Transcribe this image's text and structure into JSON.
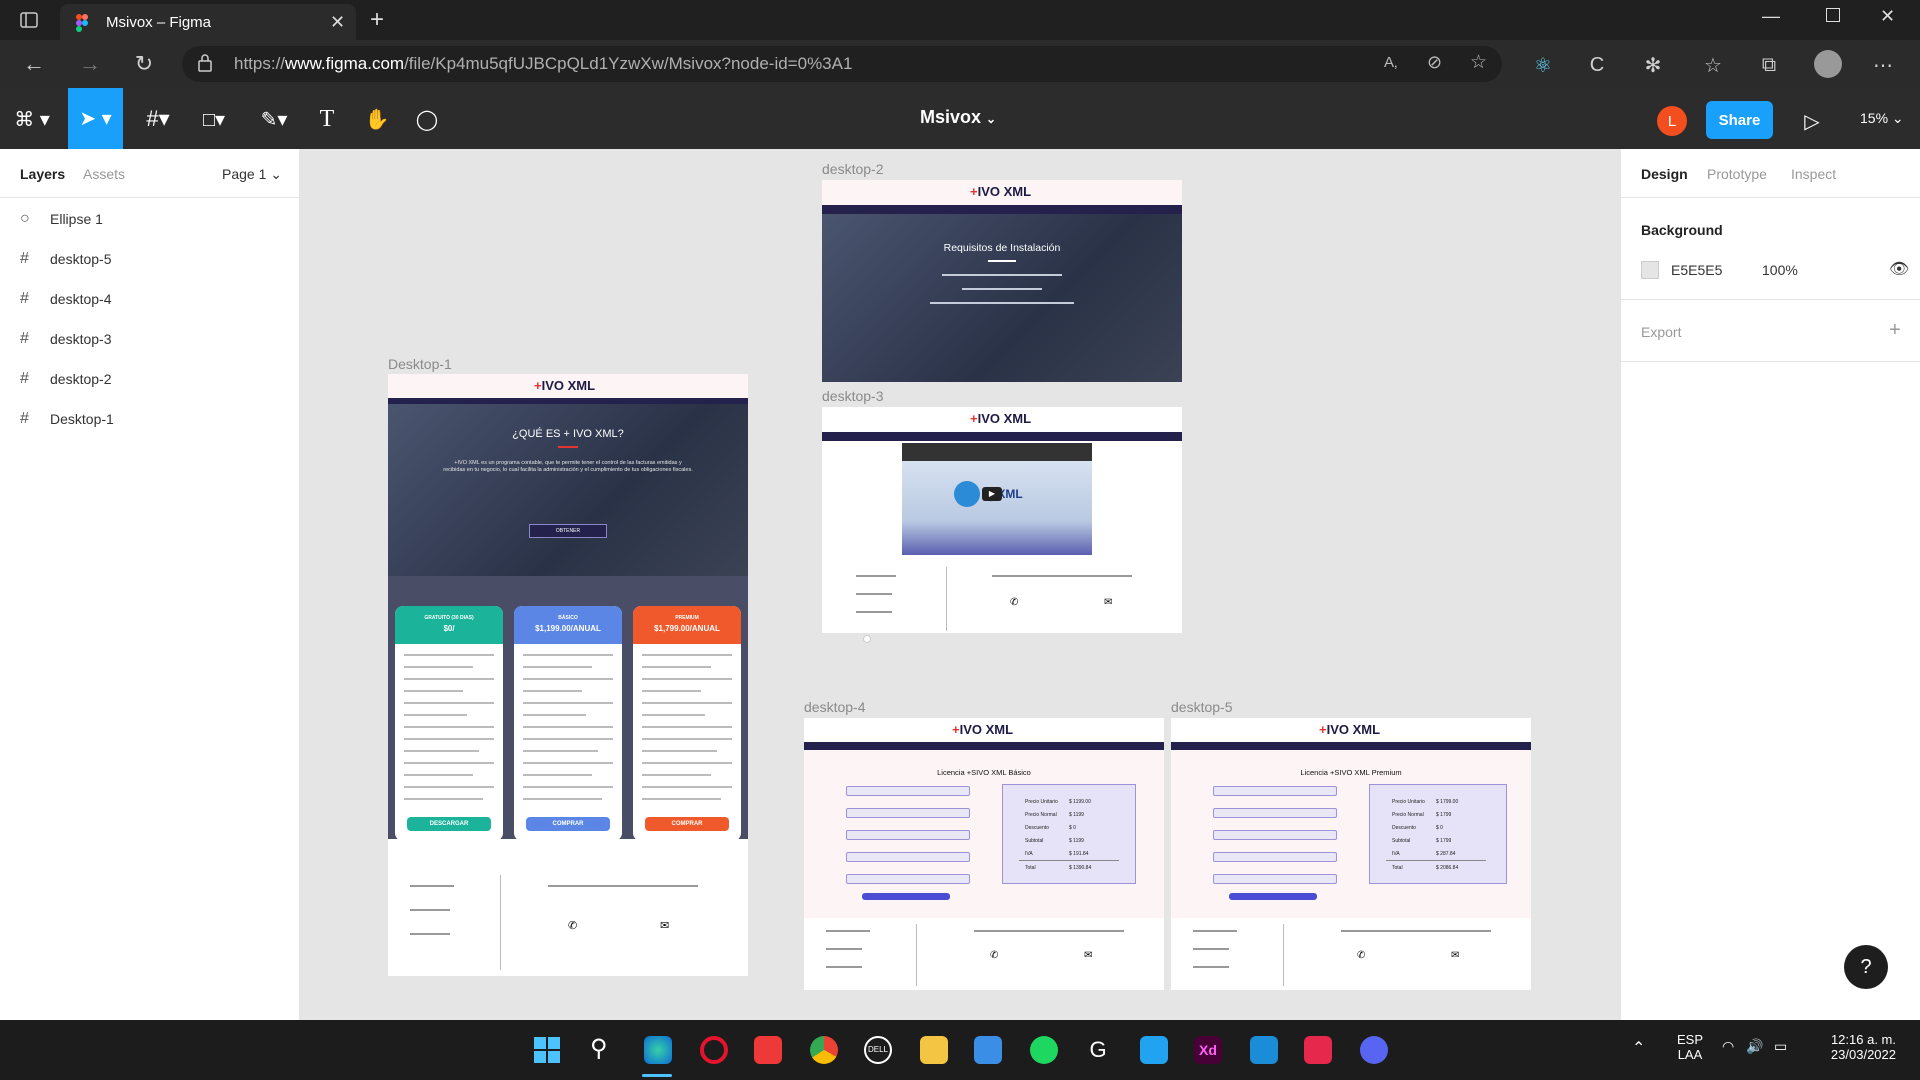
{
  "browser": {
    "tab_title": "Msivox – Figma",
    "url_prefix": "https://",
    "url_host": "www.figma.com",
    "url_path": "/file/Kp4mu5qfUJBCpQLd1YzwXw/Msivox?node-id=0%3A1"
  },
  "toolbar": {
    "file_name": "Msivox",
    "share_label": "Share",
    "zoom": "15%",
    "avatar_initial": "L"
  },
  "left_panel": {
    "tabs": [
      "Layers",
      "Assets"
    ],
    "page": "Page 1",
    "layers": [
      {
        "icon": "ellipse-icon",
        "name": "Ellipse 1"
      },
      {
        "icon": "frame-icon",
        "name": "desktop-5"
      },
      {
        "icon": "frame-icon",
        "name": "desktop-4"
      },
      {
        "icon": "frame-icon",
        "name": "desktop-3"
      },
      {
        "icon": "frame-icon",
        "name": "desktop-2"
      },
      {
        "icon": "frame-icon",
        "name": "Desktop-1"
      }
    ]
  },
  "right_panel": {
    "tabs": [
      "Design",
      "Prototype",
      "Inspect"
    ],
    "background_title": "Background",
    "bg_hex": "E5E5E5",
    "bg_opacity": "100%",
    "export_label": "Export"
  },
  "canvas": {
    "frames": {
      "d1_label": "Desktop-1",
      "d2_label": "desktop-2",
      "d3_label": "desktop-3",
      "d4_label": "desktop-4",
      "d5_label": "desktop-5"
    },
    "logo": "IVO XML",
    "logo_plus": "+",
    "d1": {
      "hero_title": "¿QUÉ ES + IVO XML?",
      "hero_text": "+IVO XML es un programa contable, que te permite tener el control de las facturas emitidas y recibidas en tu negocio, lo cual facilita la administración y el cumplimiento de tus obligaciones fiscales.",
      "hero_button": "OBTENER",
      "plans": [
        {
          "name": "GRATUITO (30 DIAS)",
          "price": "$0/",
          "button": "DESCARGAR"
        },
        {
          "name": "BÁSICO",
          "price": "$1,199.00/ANUAL",
          "button": "COMPRAR"
        },
        {
          "name": "PREMIUM",
          "price": "$1,799.00/ANUAL",
          "button": "COMPRAR"
        }
      ]
    },
    "d2": {
      "title": "Requisitos de Instalación"
    },
    "d4": {
      "title": "Licencia +SIVO XML Básico",
      "rows": [
        [
          "Precio Unitario",
          "$ 1199.00"
        ],
        [
          "Precio Normal",
          "$ 1199"
        ],
        [
          "Descuento",
          "$ 0"
        ],
        [
          "Subtotal",
          "$ 1199"
        ],
        [
          "IVA",
          "$ 191.84"
        ],
        [
          "Total",
          "$ 1390.84"
        ]
      ]
    },
    "d5": {
      "title": "Licencia +SIVO XML Premium",
      "rows": [
        [
          "Precio Unitario",
          "$ 1799.00"
        ],
        [
          "Precio Normal",
          "$ 1799"
        ],
        [
          "Descuento",
          "$ 0"
        ],
        [
          "Subtotal",
          "$ 1799"
        ],
        [
          "IVA",
          "$ 287.84"
        ],
        [
          "Total",
          "$ 2086.84"
        ]
      ]
    }
  },
  "help_label": "?",
  "taskbar": {
    "lang_top": "ESP",
    "lang_bottom": "LAA",
    "time": "12:16 a. m.",
    "date": "23/03/2022"
  },
  "colors": {
    "figma_blue": "#18a0fb",
    "navy": "#24214d",
    "plan_teal": "#1bb39a",
    "plan_blue": "#5b86e5",
    "plan_orange": "#f0592b"
  }
}
